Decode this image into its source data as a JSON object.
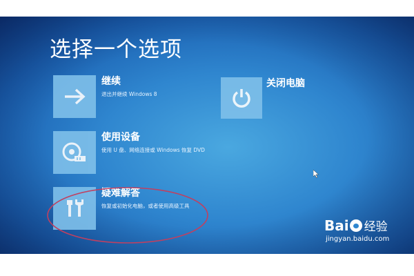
{
  "screen": {
    "title": "选择一个选项"
  },
  "options": {
    "continue": {
      "label": "继续",
      "description": "退出并继续 Windows 8",
      "icon": "arrow-right-icon"
    },
    "use_device": {
      "label": "使用设备",
      "description": "使用 U 盘、网络连接或 Windows 恢复 DVD",
      "icon": "disc-drive-icon"
    },
    "troubleshoot": {
      "label": "疑难解答",
      "description": "恢复或初始化电脑，或者使用高级工具",
      "icon": "tools-icon"
    },
    "shutdown": {
      "label": "关闭电脑",
      "icon": "power-icon"
    }
  },
  "watermark": {
    "logo_left": "Bai",
    "logo_right": "经验",
    "url": "jingyan.baidu.com"
  },
  "colors": {
    "background": "#2f86cf",
    "tile": "#7fc0ea",
    "annotation": "#c04060"
  }
}
